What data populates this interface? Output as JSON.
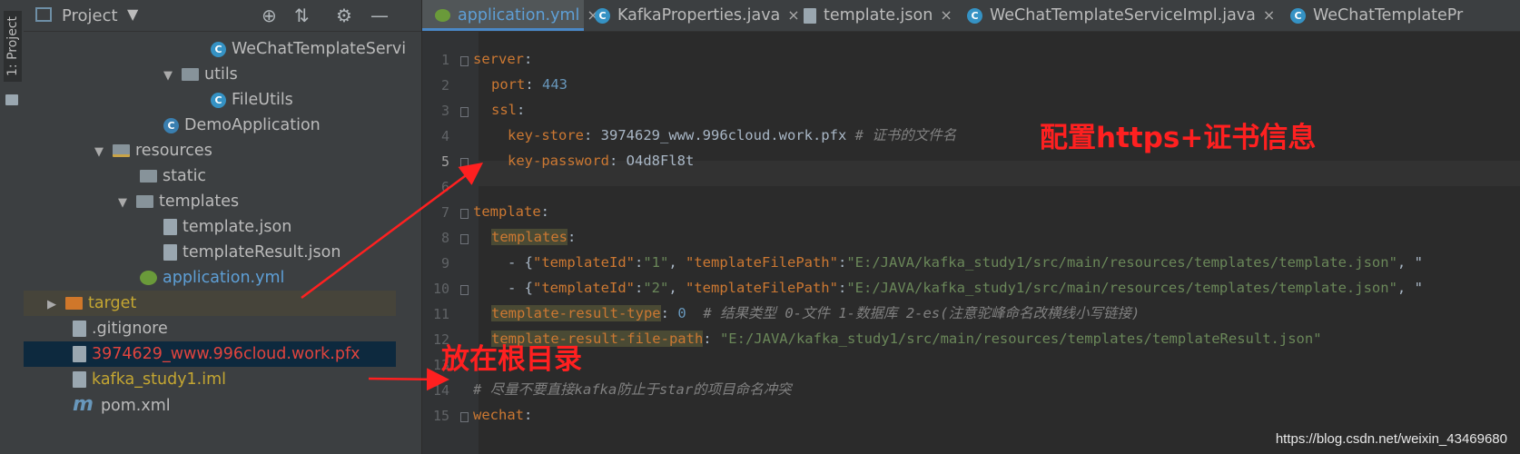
{
  "tool_stripe": {
    "label": "1: Project"
  },
  "project_panel": {
    "title": "Project",
    "toolbar_icons": [
      "target-icon",
      "collapse-icon",
      "gear-icon",
      "minimize-icon"
    ],
    "tree": [
      {
        "label": "WeChatTemplateServi",
        "icon": "java-class-icon"
      },
      {
        "label": "utils",
        "icon": "package-icon",
        "expanded": true
      },
      {
        "label": "FileUtils",
        "icon": "java-class-icon"
      },
      {
        "label": "DemoApplication",
        "icon": "spring-app-icon"
      },
      {
        "label": "resources",
        "icon": "resources-folder-icon",
        "expanded": true
      },
      {
        "label": "static",
        "icon": "folder-icon"
      },
      {
        "label": "templates",
        "icon": "folder-icon",
        "expanded": true
      },
      {
        "label": "template.json",
        "icon": "json-file-icon"
      },
      {
        "label": "templateResult.json",
        "icon": "json-file-icon"
      },
      {
        "label": "application.yml",
        "icon": "yml-file-icon"
      },
      {
        "label": "target",
        "icon": "excluded-folder-icon",
        "expanded": false
      },
      {
        "label": ".gitignore",
        "icon": "text-file-icon"
      },
      {
        "label": "3974629_www.996cloud.work.pfx",
        "icon": "unknown-file-icon"
      },
      {
        "label": "kafka_study1.iml",
        "icon": "iml-file-icon"
      },
      {
        "label": "pom.xml",
        "icon": "maven-icon"
      }
    ]
  },
  "tabs": [
    {
      "label": "application.yml",
      "icon": "yml-file-icon",
      "active": true
    },
    {
      "label": "KafkaProperties.java",
      "icon": "java-class-icon"
    },
    {
      "label": "template.json",
      "icon": "json-file-icon"
    },
    {
      "label": "WeChatTemplateServiceImpl.java",
      "icon": "java-class-icon"
    },
    {
      "label": "WeChatTemplatePr",
      "icon": "java-class-icon"
    }
  ],
  "editor": {
    "line_numbers": [
      "1",
      "2",
      "3",
      "4",
      "5",
      "6",
      "7",
      "8",
      "9",
      "10",
      "11",
      "12",
      "13",
      "14",
      "15"
    ],
    "current_line": "5",
    "lines": {
      "l1_key": "server",
      "l1_colon": ":",
      "l2_key": "port",
      "l2_val": "443",
      "l3_key": "ssl",
      "l4_key": "key-store",
      "l4_val": "3974629_www.996cloud.work.pfx",
      "l4_comment": "# 证书的文件名",
      "l5_key": "key-password",
      "l5_val": "O4d8Fl8t",
      "l7_key": "template",
      "l8_key": "templates",
      "l9_dash": "- {",
      "l9_k1": "\"templateId\"",
      "l9_v1": "\"1\"",
      "l9_k2": "\"templateFilePath\"",
      "l9_v2": "\"E:/JAVA/kafka_study1/src/main/resources/templates/template.json\"",
      "l9_tail": ", \"",
      "l10_dash": "- {",
      "l10_k1": "\"templateId\"",
      "l10_v1": "\"2\"",
      "l10_k2": "\"templateFilePath\"",
      "l10_v2": "\"E:/JAVA/kafka_study1/src/main/resources/templates/template.json\"",
      "l10_tail": ", \"",
      "l11_key": "template-result-type",
      "l11_val": "0",
      "l11_comment": "# 结果类型 0-文件 1-数据库 2-es(注意驼峰命名改横线小写链接)",
      "l12_key": "template-result-file-path",
      "l12_val": "\"E:/JAVA/kafka_study1/src/main/resources/templates/templateResult.json\"",
      "l14_comment": "# 尽量不要直接kafka防止于star的项目命名冲突",
      "l15_key": "wechat"
    }
  },
  "annotations": {
    "top": "配置https+证书信息",
    "bottom": "放在根目录",
    "color": "#ff2020"
  },
  "watermark": "https://blog.csdn.net/weixin_43469680"
}
